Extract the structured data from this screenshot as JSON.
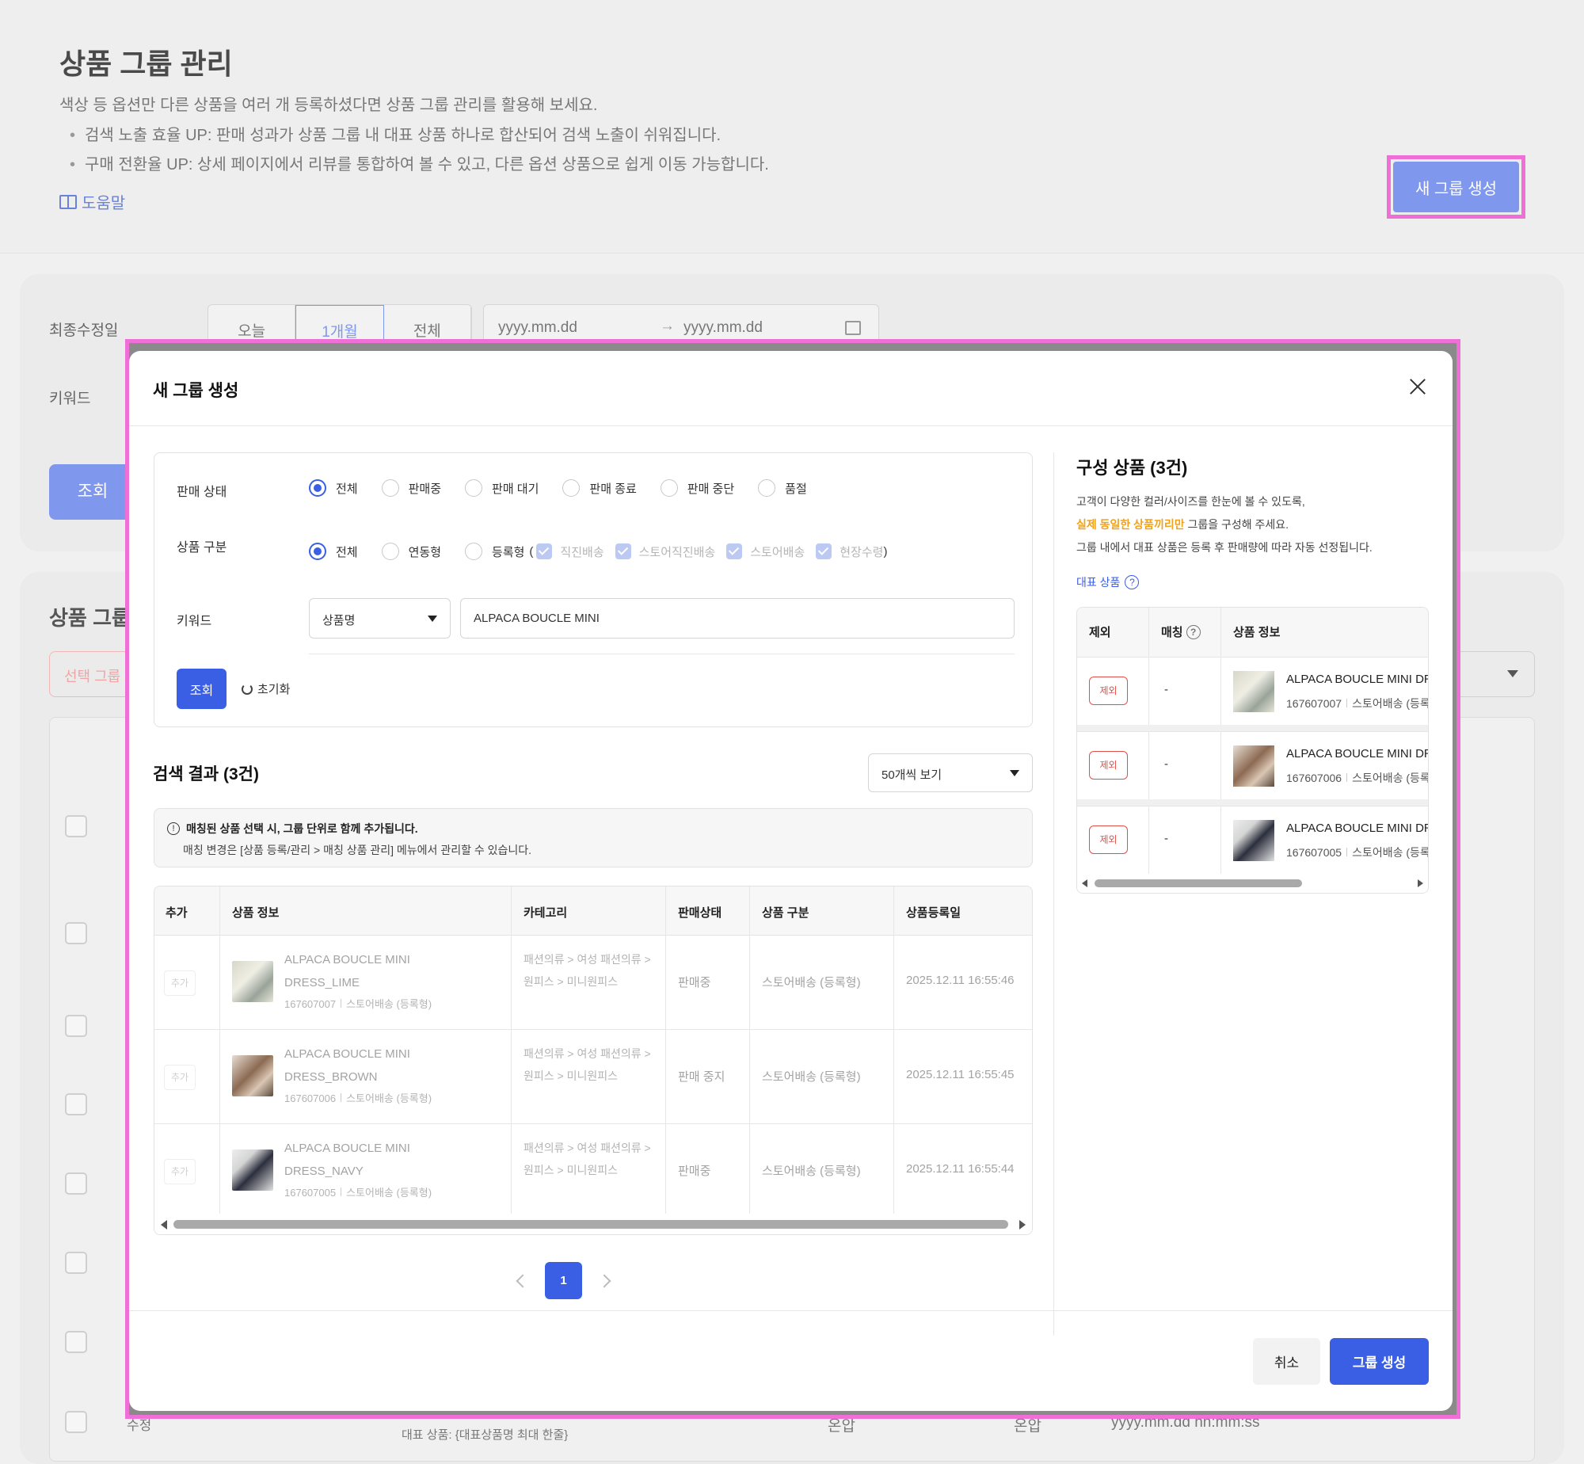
{
  "page": {
    "title": "상품 그룹 관리",
    "desc": "색상 등 옵션만 다른 상품을 여러 개 등록하셨다면 상품 그룹 관리를 활용해 보세요.",
    "bullet1": "검색 노출 효율 UP: 판매 성과가 상품 그룹 내 대표 상품 하나로 합산되어 검색 노출이 쉬워집니다.",
    "bullet2": "구매 전환율 UP: 상세 페이지에서 리뷰를 통합하여 볼 수 있고, 다른 옵션 상품으로 쉽게 이동 가능합니다.",
    "help": "도움말",
    "new_group_button": "새 그룹 생성"
  },
  "filter": {
    "last_modified_label": "최종수정일",
    "keyword_label": "키워드",
    "periods": [
      "오늘",
      "1개월",
      "전체"
    ],
    "date_from": "yyyy.mm.dd",
    "date_to": "yyyy.mm.dd",
    "search_button": "조회"
  },
  "list": {
    "title": "상품 그룹",
    "select_placeholder": "선택 그룹",
    "row_edit": "수정",
    "row_rep": "대표 상품: {대표상품명 최대 한줄}",
    "row_status1": "온압",
    "row_status2": "온압",
    "row_date": "yyyy.mm.dd hh:mm:ss"
  },
  "modal": {
    "title": "새 그룹 생성",
    "sale_status_label": "판매 상태",
    "sale_status_options": [
      "전체",
      "판매중",
      "판매 대기",
      "판매 종료",
      "판매 중단",
      "품절"
    ],
    "product_type_label": "상품 구분",
    "product_type_options": [
      "전체",
      "연동형",
      "등록형"
    ],
    "delivery_options": [
      "직진배송",
      "스토어직진배송",
      "스토어배송",
      "현장수령"
    ],
    "paren_open": "(",
    "paren_close": ")",
    "keyword_label": "키워드",
    "keyword_type": "상품명",
    "keyword_value": "ALPACA BOUCLE MINI",
    "search_button": "조회",
    "reset_button": "초기화",
    "results_title": "검색 결과 (3건)",
    "per_page": "50개씩 보기",
    "notice_line1": "매칭된 상품 선택 시, 그룹 단위로 함께 추가됩니다.",
    "notice_line2": "매칭 변경은 [상품 등록/관리 > 매칭 상품 관리] 메뉴에서 관리할 수 있습니다.",
    "table_headers": [
      "추가",
      "상품 정보",
      "카테고리",
      "판매상태",
      "상품 구분",
      "상품등록일"
    ],
    "rows": [
      {
        "add": "추가",
        "name": "ALPACA BOUCLE MINI DRESS_LIME",
        "id": "167607007",
        "delivery": "스토어배송 (등록형)",
        "category": "패션의류 > 여성 패션의류 > 원피스 > 미니원피스",
        "status": "판매중",
        "type": "스토어배송 (등록형)",
        "date": "2025.12.11 16:55:46"
      },
      {
        "add": "추가",
        "name": "ALPACA BOUCLE MINI DRESS_BROWN",
        "id": "167607006",
        "delivery": "스토어배송 (등록형)",
        "category": "패션의류 > 여성 패션의류 > 원피스 > 미니원피스",
        "status": "판매 중지",
        "type": "스토어배송 (등록형)",
        "date": "2025.12.11 16:55:45"
      },
      {
        "add": "추가",
        "name": "ALPACA BOUCLE MINI DRESS_NAVY",
        "id": "167607005",
        "delivery": "스토어배송 (등록형)",
        "category": "패션의류 > 여성 패션의류 > 원피스 > 미니원피스",
        "status": "판매중",
        "type": "스토어배송 (등록형)",
        "date": "2025.12.11 16:55:44"
      }
    ],
    "page_number": "1",
    "composition_title": "구성 상품 (3건)",
    "composition_desc1": "고객이 다양한 컬러/사이즈를 한눈에 볼 수 있도록,",
    "composition_desc2_highlight": "실제 동일한 상품끼리만",
    "composition_desc2_rest": " 그룹을 구성해 주세요.",
    "composition_desc3": "그룹 내에서 대표 상품은 등록 후 판매량에 따라 자동 선정됩니다.",
    "rep_product_link": "대표 상품",
    "comp_headers": [
      "제외",
      "매칭",
      "상품 정보"
    ],
    "comp_rows": [
      {
        "exclude": "제외",
        "match": "-",
        "name": "ALPACA BOUCLE MINI DRESS_LIME",
        "id": "167607007",
        "delivery": "스토어배송 (등록형)"
      },
      {
        "exclude": "제외",
        "match": "-",
        "name": "ALPACA BOUCLE MINI DRESS_BROWN",
        "id": "167607006",
        "delivery": "스토어배송 (등록형)"
      },
      {
        "exclude": "제외",
        "match": "-",
        "name": "ALPACA BOUCLE MINI DRESS_NAVY",
        "id": "167607005",
        "delivery": "스토어배송 (등록형)"
      }
    ],
    "cancel_button": "취소",
    "create_button": "그룹 생성"
  },
  "colors": {
    "primary": "#3a5fe5",
    "accent_faded": "#7f97ec",
    "highlight_frame": "#f06fd6",
    "exclude_red": "#e0504a",
    "warning_orange": "#f0a21b"
  }
}
